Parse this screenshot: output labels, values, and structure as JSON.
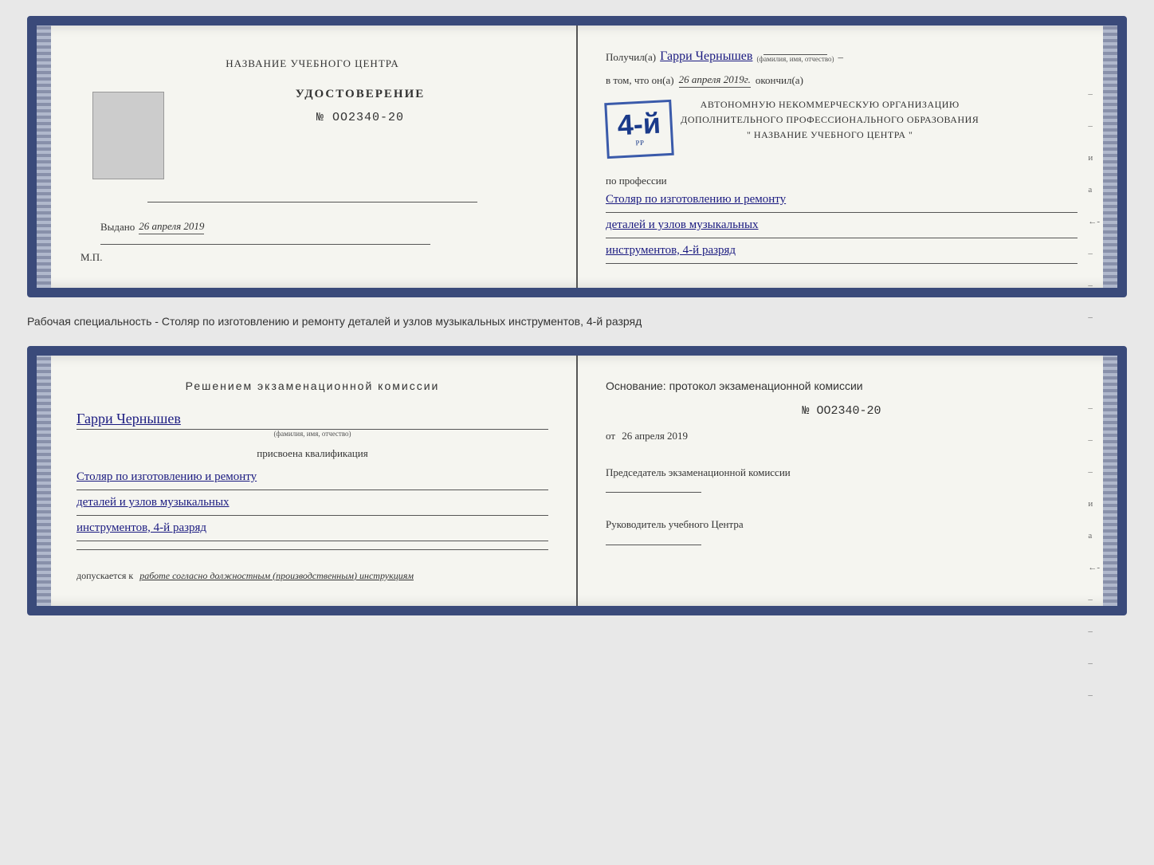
{
  "top_doc": {
    "left": {
      "center_title": "НАЗВАНИЕ УЧЕБНОГО ЦЕНТРА",
      "cert_label": "УДОСТОВЕРЕНИЕ",
      "cert_number": "№ OO2340-20",
      "issued_label": "Выдано",
      "issued_date": "26 апреля 2019",
      "mp_label": "М.П."
    },
    "right": {
      "recipient_prefix": "Получил(а)",
      "recipient_name": "Гарри Чернышев",
      "recipient_sub": "(фамилия, имя, отчество)",
      "vtom_prefix": "в том, что он(а)",
      "vtom_date": "26 апреля 2019г.",
      "vtom_suffix": "окончил(а)",
      "stamp_rank": "4-й",
      "stamp_line1": "АВТОНОМНУЮ НЕКОММЕРЧЕСКУЮ ОРГАНИЗАЦИЮ",
      "stamp_line2": "ДОПОЛНИТЕЛЬНОГО ПРОФЕССИОНАЛЬНОГО ОБРАЗОВАНИЯ",
      "stamp_line3": "\" НАЗВАНИЕ УЧЕБНОГО ЦЕНТРА \"",
      "profession_label": "по профессии",
      "profession_line1": "Столяр по изготовлению и ремонту",
      "profession_line2": "деталей и узлов музыкальных",
      "profession_line3": "инструментов, 4-й разряд"
    }
  },
  "caption": "Рабочая специальность - Столяр по изготовлению и ремонту деталей и узлов музыкальных инструментов, 4-й разряд",
  "bottom_doc": {
    "left": {
      "resolution_title": "Решением  экзаменационной  комиссии",
      "name": "Гарри Чернышев",
      "name_sub": "(фамилия, имя, отчество)",
      "assigned_label": "присвоена квалификация",
      "qualification_line1": "Столяр по изготовлению и ремонту",
      "qualification_line2": "деталей и узлов музыкальных",
      "qualification_line3": "инструментов, 4-й разряд",
      "allowed_prefix": "допускается к",
      "allowed_text": "работе согласно должностным (производственным) инструкциям"
    },
    "right": {
      "basis_label": "Основание: протокол экзаменационной  комиссии",
      "protocol_number": "№  OO2340-20",
      "protocol_date_prefix": "от",
      "protocol_date": "26 апреля 2019",
      "chairman_label": "Председатель экзаменационной комиссии",
      "director_label": "Руководитель учебного Центра"
    }
  }
}
